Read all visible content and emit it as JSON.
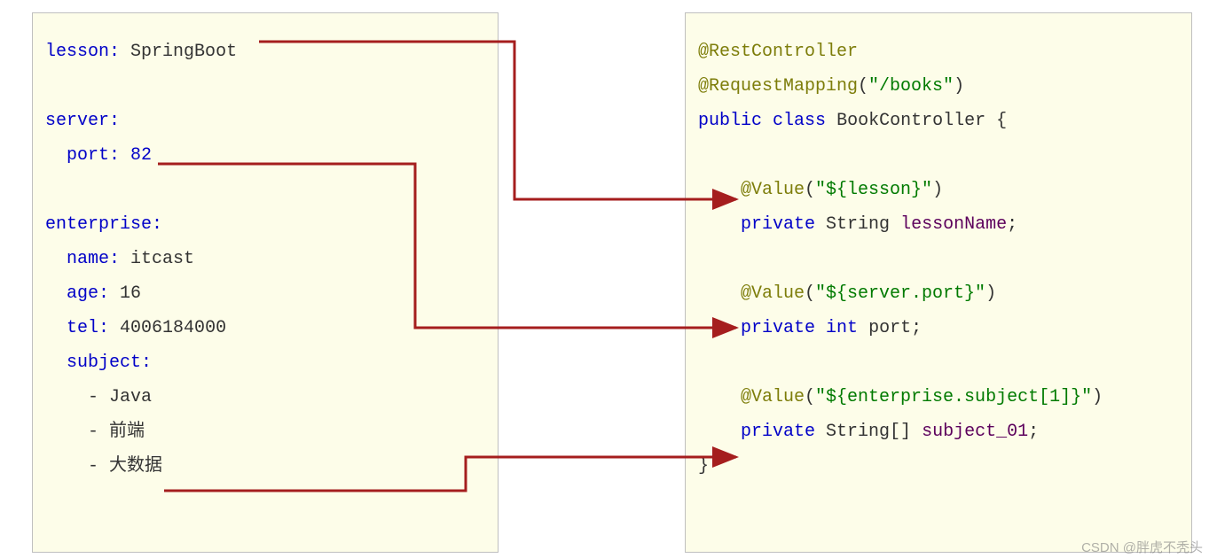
{
  "yaml": {
    "lesson_key": "lesson",
    "lesson_val": "SpringBoot",
    "server_key": "server",
    "port_key": "port",
    "port_val": "82",
    "enterprise_key": "enterprise",
    "name_key": "name",
    "name_val": "itcast",
    "age_key": "age",
    "age_val": "16",
    "tel_key": "tel",
    "tel_val": "4006184000",
    "subject_key": "subject",
    "subj_1": "Java",
    "subj_2": "前端",
    "subj_3": "大数据"
  },
  "java": {
    "anno_rest": "@RestController",
    "anno_mapping_name": "@RequestMapping",
    "anno_mapping_arg": "\"/books\"",
    "kw_public": "public",
    "kw_class": "class",
    "class_name": "BookController",
    "brace_open": "{",
    "brace_close": "}",
    "anno_value": "@Value",
    "val1_arg": "\"${lesson}\"",
    "kw_private": "private",
    "type_string": "String",
    "type_int": "int",
    "type_string_arr": "String[]",
    "field_lesson": "lessonName",
    "val2_arg": "\"${server.port}\"",
    "field_port": "port",
    "val3_arg": "\"${enterprise.subject[1]}\"",
    "field_subject": "subject_01",
    "semi": ";",
    "lparen": "(",
    "rparen": ")",
    "colon": ":",
    "dash": "- "
  },
  "watermark": "CSDN @胖虎不秃头"
}
